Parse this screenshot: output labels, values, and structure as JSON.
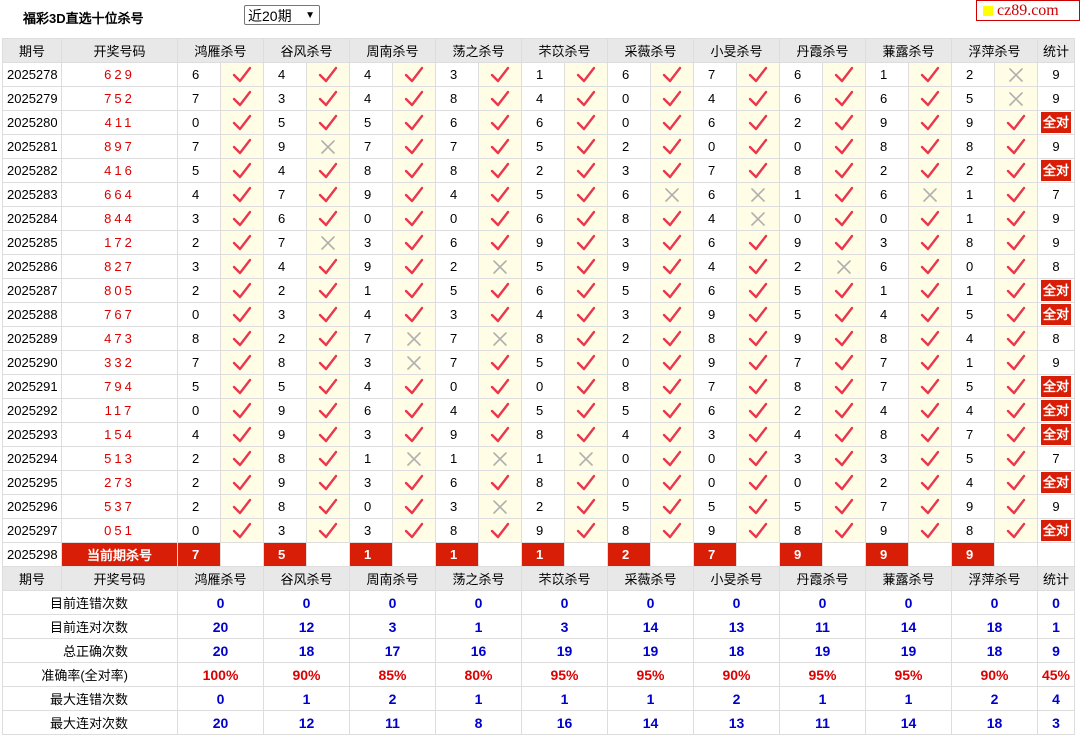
{
  "page_title": "福彩3D直选十位杀号",
  "period_select": "近20期",
  "logo_text": "cz89.com",
  "headers": [
    "期号",
    "开奖号码",
    "鸿雁杀号",
    "谷风杀号",
    "周南杀号",
    "荡之杀号",
    "芣苡杀号",
    "采薇杀号",
    "小旻杀号",
    "丹霞杀号",
    "蒹露杀号",
    "浮萍杀号",
    "统计"
  ],
  "rows": [
    {
      "period": "2025278",
      "draw": "629",
      "picks": [
        [
          6,
          1
        ],
        [
          4,
          1
        ],
        [
          4,
          1
        ],
        [
          3,
          1
        ],
        [
          1,
          1
        ],
        [
          6,
          1
        ],
        [
          7,
          1
        ],
        [
          6,
          1
        ],
        [
          1,
          1
        ],
        [
          2,
          0
        ]
      ],
      "stat": "9"
    },
    {
      "period": "2025279",
      "draw": "752",
      "picks": [
        [
          7,
          1
        ],
        [
          3,
          1
        ],
        [
          4,
          1
        ],
        [
          8,
          1
        ],
        [
          4,
          1
        ],
        [
          0,
          1
        ],
        [
          4,
          1
        ],
        [
          6,
          1
        ],
        [
          6,
          1
        ],
        [
          5,
          0
        ]
      ],
      "stat": "9"
    },
    {
      "period": "2025280",
      "draw": "411",
      "picks": [
        [
          0,
          1
        ],
        [
          5,
          1
        ],
        [
          5,
          1
        ],
        [
          6,
          1
        ],
        [
          6,
          1
        ],
        [
          0,
          1
        ],
        [
          6,
          1
        ],
        [
          2,
          1
        ],
        [
          9,
          1
        ],
        [
          9,
          1
        ]
      ],
      "stat": "全对"
    },
    {
      "period": "2025281",
      "draw": "897",
      "picks": [
        [
          7,
          1
        ],
        [
          9,
          0
        ],
        [
          7,
          1
        ],
        [
          7,
          1
        ],
        [
          5,
          1
        ],
        [
          2,
          1
        ],
        [
          0,
          1
        ],
        [
          0,
          1
        ],
        [
          8,
          1
        ],
        [
          8,
          1
        ]
      ],
      "stat": "9"
    },
    {
      "period": "2025282",
      "draw": "416",
      "picks": [
        [
          5,
          1
        ],
        [
          4,
          1
        ],
        [
          8,
          1
        ],
        [
          8,
          1
        ],
        [
          2,
          1
        ],
        [
          3,
          1
        ],
        [
          7,
          1
        ],
        [
          8,
          1
        ],
        [
          2,
          1
        ],
        [
          2,
          1
        ]
      ],
      "stat": "全对"
    },
    {
      "period": "2025283",
      "draw": "664",
      "picks": [
        [
          4,
          1
        ],
        [
          7,
          1
        ],
        [
          9,
          1
        ],
        [
          4,
          1
        ],
        [
          5,
          1
        ],
        [
          6,
          0
        ],
        [
          6,
          0
        ],
        [
          1,
          1
        ],
        [
          6,
          0
        ],
        [
          1,
          1
        ]
      ],
      "stat": "7"
    },
    {
      "period": "2025284",
      "draw": "844",
      "picks": [
        [
          3,
          1
        ],
        [
          6,
          1
        ],
        [
          0,
          1
        ],
        [
          0,
          1
        ],
        [
          6,
          1
        ],
        [
          8,
          1
        ],
        [
          4,
          0
        ],
        [
          0,
          1
        ],
        [
          0,
          1
        ],
        [
          1,
          1
        ]
      ],
      "stat": "9"
    },
    {
      "period": "2025285",
      "draw": "172",
      "picks": [
        [
          2,
          1
        ],
        [
          7,
          0
        ],
        [
          3,
          1
        ],
        [
          6,
          1
        ],
        [
          9,
          1
        ],
        [
          3,
          1
        ],
        [
          6,
          1
        ],
        [
          9,
          1
        ],
        [
          3,
          1
        ],
        [
          8,
          1
        ]
      ],
      "stat": "9"
    },
    {
      "period": "2025286",
      "draw": "827",
      "picks": [
        [
          3,
          1
        ],
        [
          4,
          1
        ],
        [
          9,
          1
        ],
        [
          2,
          0
        ],
        [
          5,
          1
        ],
        [
          9,
          1
        ],
        [
          4,
          1
        ],
        [
          2,
          0
        ],
        [
          6,
          1
        ],
        [
          0,
          1
        ]
      ],
      "stat": "8"
    },
    {
      "period": "2025287",
      "draw": "805",
      "picks": [
        [
          2,
          1
        ],
        [
          2,
          1
        ],
        [
          1,
          1
        ],
        [
          5,
          1
        ],
        [
          6,
          1
        ],
        [
          5,
          1
        ],
        [
          6,
          1
        ],
        [
          5,
          1
        ],
        [
          1,
          1
        ],
        [
          1,
          1
        ]
      ],
      "stat": "全对"
    },
    {
      "period": "2025288",
      "draw": "767",
      "picks": [
        [
          0,
          1
        ],
        [
          3,
          1
        ],
        [
          4,
          1
        ],
        [
          3,
          1
        ],
        [
          4,
          1
        ],
        [
          3,
          1
        ],
        [
          9,
          1
        ],
        [
          5,
          1
        ],
        [
          4,
          1
        ],
        [
          5,
          1
        ]
      ],
      "stat": "全对"
    },
    {
      "period": "2025289",
      "draw": "473",
      "picks": [
        [
          8,
          1
        ],
        [
          2,
          1
        ],
        [
          7,
          0
        ],
        [
          7,
          0
        ],
        [
          8,
          1
        ],
        [
          2,
          1
        ],
        [
          8,
          1
        ],
        [
          9,
          1
        ],
        [
          8,
          1
        ],
        [
          4,
          1
        ]
      ],
      "stat": "8"
    },
    {
      "period": "2025290",
      "draw": "332",
      "picks": [
        [
          7,
          1
        ],
        [
          8,
          1
        ],
        [
          3,
          0
        ],
        [
          7,
          1
        ],
        [
          5,
          1
        ],
        [
          0,
          1
        ],
        [
          9,
          1
        ],
        [
          7,
          1
        ],
        [
          7,
          1
        ],
        [
          1,
          1
        ]
      ],
      "stat": "9"
    },
    {
      "period": "2025291",
      "draw": "794",
      "picks": [
        [
          5,
          1
        ],
        [
          5,
          1
        ],
        [
          4,
          1
        ],
        [
          0,
          1
        ],
        [
          0,
          1
        ],
        [
          8,
          1
        ],
        [
          7,
          1
        ],
        [
          8,
          1
        ],
        [
          7,
          1
        ],
        [
          5,
          1
        ]
      ],
      "stat": "全对"
    },
    {
      "period": "2025292",
      "draw": "117",
      "picks": [
        [
          0,
          1
        ],
        [
          9,
          1
        ],
        [
          6,
          1
        ],
        [
          4,
          1
        ],
        [
          5,
          1
        ],
        [
          5,
          1
        ],
        [
          6,
          1
        ],
        [
          2,
          1
        ],
        [
          4,
          1
        ],
        [
          4,
          1
        ]
      ],
      "stat": "全对"
    },
    {
      "period": "2025293",
      "draw": "154",
      "picks": [
        [
          4,
          1
        ],
        [
          9,
          1
        ],
        [
          3,
          1
        ],
        [
          9,
          1
        ],
        [
          8,
          1
        ],
        [
          4,
          1
        ],
        [
          3,
          1
        ],
        [
          4,
          1
        ],
        [
          8,
          1
        ],
        [
          7,
          1
        ]
      ],
      "stat": "全对"
    },
    {
      "period": "2025294",
      "draw": "513",
      "picks": [
        [
          2,
          1
        ],
        [
          8,
          1
        ],
        [
          1,
          0
        ],
        [
          1,
          0
        ],
        [
          1,
          0
        ],
        [
          0,
          1
        ],
        [
          0,
          1
        ],
        [
          3,
          1
        ],
        [
          3,
          1
        ],
        [
          5,
          1
        ]
      ],
      "stat": "7"
    },
    {
      "period": "2025295",
      "draw": "273",
      "picks": [
        [
          2,
          1
        ],
        [
          9,
          1
        ],
        [
          3,
          1
        ],
        [
          6,
          1
        ],
        [
          8,
          1
        ],
        [
          0,
          1
        ],
        [
          0,
          1
        ],
        [
          0,
          1
        ],
        [
          2,
          1
        ],
        [
          4,
          1
        ]
      ],
      "stat": "全对"
    },
    {
      "period": "2025296",
      "draw": "537",
      "picks": [
        [
          2,
          1
        ],
        [
          8,
          1
        ],
        [
          0,
          1
        ],
        [
          3,
          0
        ],
        [
          2,
          1
        ],
        [
          5,
          1
        ],
        [
          5,
          1
        ],
        [
          5,
          1
        ],
        [
          7,
          1
        ],
        [
          9,
          1
        ]
      ],
      "stat": "9"
    },
    {
      "period": "2025297",
      "draw": "051",
      "picks": [
        [
          0,
          1
        ],
        [
          3,
          1
        ],
        [
          3,
          1
        ],
        [
          8,
          1
        ],
        [
          9,
          1
        ],
        [
          8,
          1
        ],
        [
          9,
          1
        ],
        [
          8,
          1
        ],
        [
          9,
          1
        ],
        [
          8,
          1
        ]
      ],
      "stat": "全对"
    }
  ],
  "current": {
    "period": "2025298",
    "label": "当前期杀号",
    "picks": [
      "7",
      "5",
      "1",
      "1",
      "1",
      "2",
      "7",
      "9",
      "9",
      "9"
    ]
  },
  "stats": [
    {
      "label": "目前连错次数",
      "values": [
        "0",
        "0",
        "0",
        "0",
        "0",
        "0",
        "0",
        "0",
        "0",
        "0",
        "0"
      ]
    },
    {
      "label": "目前连对次数",
      "values": [
        "20",
        "12",
        "3",
        "1",
        "3",
        "14",
        "13",
        "11",
        "14",
        "18",
        "1"
      ]
    },
    {
      "label": "总正确次数",
      "values": [
        "20",
        "18",
        "17",
        "16",
        "19",
        "19",
        "18",
        "19",
        "19",
        "18",
        "9"
      ]
    },
    {
      "label": "准确率(全对率)",
      "values": [
        "100%",
        "90%",
        "85%",
        "80%",
        "95%",
        "95%",
        "90%",
        "95%",
        "95%",
        "90%",
        "45%"
      ]
    },
    {
      "label": "最大连错次数",
      "values": [
        "0",
        "1",
        "2",
        "1",
        "1",
        "1",
        "2",
        "1",
        "1",
        "2",
        "4"
      ]
    },
    {
      "label": "最大连对次数",
      "values": [
        "20",
        "12",
        "11",
        "8",
        "16",
        "14",
        "13",
        "11",
        "14",
        "18",
        "3"
      ]
    }
  ],
  "colors": {
    "check": "#e8384f",
    "cross": "#b0b0b0",
    "accent_red": "#d81e06",
    "stat_blue": "#0000cc"
  },
  "icons": {
    "ok": "check-icon",
    "bad": "cross-icon"
  }
}
